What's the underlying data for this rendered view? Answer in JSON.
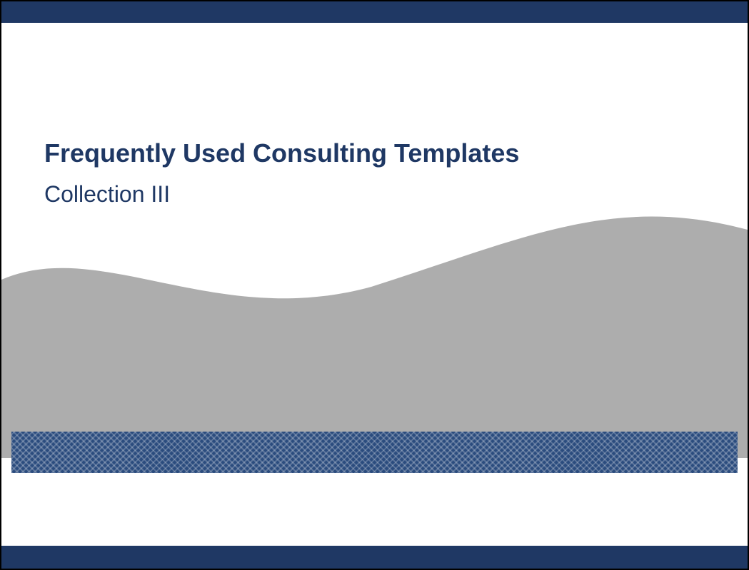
{
  "slide": {
    "title": "Frequently Used Consulting Templates",
    "subtitle": "Collection III"
  },
  "colors": {
    "brand_dark": "#1f3864",
    "wave_gray": "#adadad",
    "pattern_blue": "#2b4c7e"
  }
}
